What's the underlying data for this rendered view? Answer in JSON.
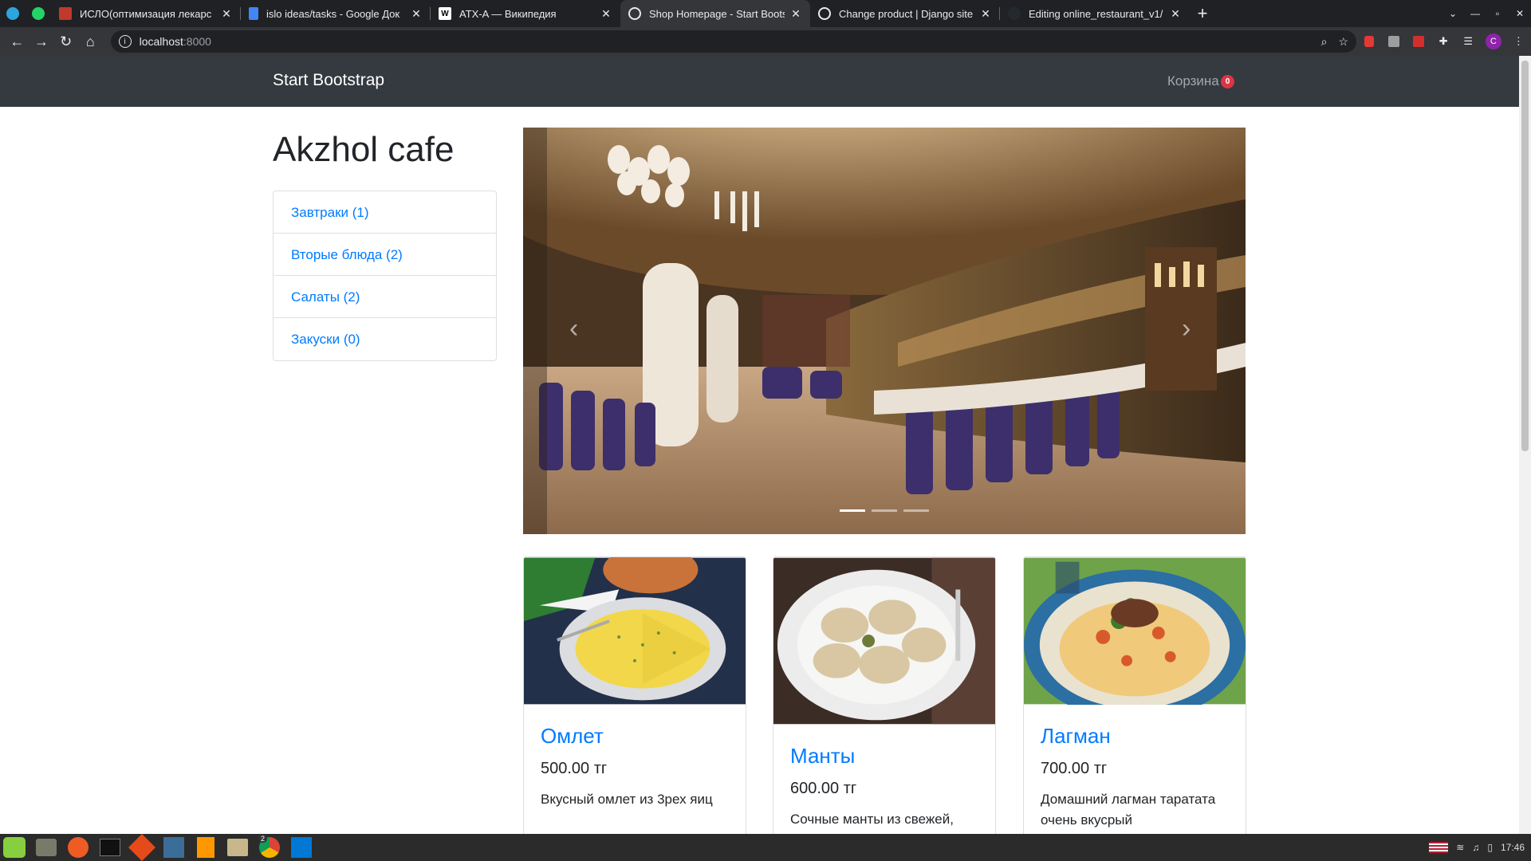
{
  "browser": {
    "tabs": [
      {
        "title": "ИСЛО(оптимизация лекарс",
        "icon": "dev-icon",
        "color": "#c0392b"
      },
      {
        "title": "islo ideas/tasks - Google Док",
        "icon": "docs-icon",
        "color": "#4285f4"
      },
      {
        "title": "ATX-A — Википедия",
        "icon": "wikipedia-icon",
        "color": "#ffffff"
      },
      {
        "title": "Shop Homepage - Start Boots",
        "icon": "globe-icon",
        "color": "#e8eaed"
      },
      {
        "title": "Change product | Django site",
        "icon": "globe-icon",
        "color": "#e8eaed"
      },
      {
        "title": "Editing online_restaurant_v1/",
        "icon": "github-icon",
        "color": "#e8eaed"
      }
    ],
    "active_tab": 3,
    "url_host": "localhost",
    "url_port": ":8000",
    "profile_initial": "C"
  },
  "site": {
    "brand": "Start Bootstrap",
    "cart_label": "Корзина",
    "cart_count": "0",
    "cafe_name": "Akzhol cafe",
    "categories": [
      {
        "label": "Завтраки (1)"
      },
      {
        "label": "Вторые блюда (2)"
      },
      {
        "label": "Салаты (2)"
      },
      {
        "label": "Закуски (0)"
      }
    ],
    "carousel": {
      "slides": 3,
      "active": 0
    },
    "products": [
      {
        "name": "Омлет",
        "price": "500.00 тг",
        "description": "Вкусный омлет из 3рех яиц"
      },
      {
        "name": "Манты",
        "price": "600.00 тг",
        "description": "Сочные манты из свежей, молодой говядины"
      },
      {
        "name": "Лагман",
        "price": "700.00 тг",
        "description": "Домашний лагман таратата очень вкусрый"
      }
    ]
  },
  "taskbar": {
    "clock": "17:46",
    "badge_count": "2"
  },
  "colors": {
    "link": "#007bff",
    "navbar": "#343a40",
    "badge": "#dc3545"
  }
}
